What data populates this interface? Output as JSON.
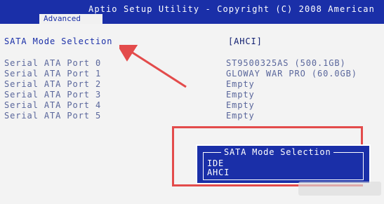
{
  "header": {
    "title": "Aptio Setup Utility - Copyright (C) 2008 American",
    "active_tab": "Advanced"
  },
  "main": {
    "selected_label": "SATA Mode Selection",
    "selected_value": "[AHCI]",
    "ports": [
      {
        "label": "Serial ATA Port 0",
        "value": "ST9500325AS      (500.1GB)"
      },
      {
        "label": "Serial ATA Port 1",
        "value": "GLOWAY WAR PRO (60.0GB)"
      },
      {
        "label": "Serial ATA Port 2",
        "value": "Empty"
      },
      {
        "label": "Serial ATA Port 3",
        "value": "Empty"
      },
      {
        "label": "Serial ATA Port 4",
        "value": "Empty"
      },
      {
        "label": "Serial ATA Port 5",
        "value": "Empty"
      }
    ]
  },
  "popup": {
    "title": "SATA Mode Selection",
    "options": [
      "IDE",
      "AHCI"
    ],
    "selected": "AHCI"
  },
  "colors": {
    "bios_blue": "#1a2fa8",
    "screen_bg": "#f3f3f3",
    "annotation_red": "#e34b4b"
  }
}
